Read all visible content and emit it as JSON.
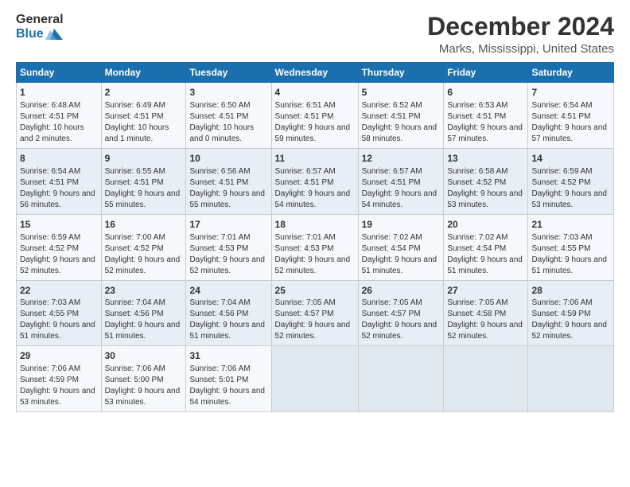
{
  "logo": {
    "general": "General",
    "blue": "Blue"
  },
  "title": "December 2024",
  "location": "Marks, Mississippi, United States",
  "days_header": [
    "Sunday",
    "Monday",
    "Tuesday",
    "Wednesday",
    "Thursday",
    "Friday",
    "Saturday"
  ],
  "weeks": [
    [
      {
        "day": "1",
        "sunrise": "Sunrise: 6:48 AM",
        "sunset": "Sunset: 4:51 PM",
        "daylight": "Daylight: 10 hours and 2 minutes."
      },
      {
        "day": "2",
        "sunrise": "Sunrise: 6:49 AM",
        "sunset": "Sunset: 4:51 PM",
        "daylight": "Daylight: 10 hours and 1 minute."
      },
      {
        "day": "3",
        "sunrise": "Sunrise: 6:50 AM",
        "sunset": "Sunset: 4:51 PM",
        "daylight": "Daylight: 10 hours and 0 minutes."
      },
      {
        "day": "4",
        "sunrise": "Sunrise: 6:51 AM",
        "sunset": "Sunset: 4:51 PM",
        "daylight": "Daylight: 9 hours and 59 minutes."
      },
      {
        "day": "5",
        "sunrise": "Sunrise: 6:52 AM",
        "sunset": "Sunset: 4:51 PM",
        "daylight": "Daylight: 9 hours and 58 minutes."
      },
      {
        "day": "6",
        "sunrise": "Sunrise: 6:53 AM",
        "sunset": "Sunset: 4:51 PM",
        "daylight": "Daylight: 9 hours and 57 minutes."
      },
      {
        "day": "7",
        "sunrise": "Sunrise: 6:54 AM",
        "sunset": "Sunset: 4:51 PM",
        "daylight": "Daylight: 9 hours and 57 minutes."
      }
    ],
    [
      {
        "day": "8",
        "sunrise": "Sunrise: 6:54 AM",
        "sunset": "Sunset: 4:51 PM",
        "daylight": "Daylight: 9 hours and 56 minutes."
      },
      {
        "day": "9",
        "sunrise": "Sunrise: 6:55 AM",
        "sunset": "Sunset: 4:51 PM",
        "daylight": "Daylight: 9 hours and 55 minutes."
      },
      {
        "day": "10",
        "sunrise": "Sunrise: 6:56 AM",
        "sunset": "Sunset: 4:51 PM",
        "daylight": "Daylight: 9 hours and 55 minutes."
      },
      {
        "day": "11",
        "sunrise": "Sunrise: 6:57 AM",
        "sunset": "Sunset: 4:51 PM",
        "daylight": "Daylight: 9 hours and 54 minutes."
      },
      {
        "day": "12",
        "sunrise": "Sunrise: 6:57 AM",
        "sunset": "Sunset: 4:51 PM",
        "daylight": "Daylight: 9 hours and 54 minutes."
      },
      {
        "day": "13",
        "sunrise": "Sunrise: 6:58 AM",
        "sunset": "Sunset: 4:52 PM",
        "daylight": "Daylight: 9 hours and 53 minutes."
      },
      {
        "day": "14",
        "sunrise": "Sunrise: 6:59 AM",
        "sunset": "Sunset: 4:52 PM",
        "daylight": "Daylight: 9 hours and 53 minutes."
      }
    ],
    [
      {
        "day": "15",
        "sunrise": "Sunrise: 6:59 AM",
        "sunset": "Sunset: 4:52 PM",
        "daylight": "Daylight: 9 hours and 52 minutes."
      },
      {
        "day": "16",
        "sunrise": "Sunrise: 7:00 AM",
        "sunset": "Sunset: 4:52 PM",
        "daylight": "Daylight: 9 hours and 52 minutes."
      },
      {
        "day": "17",
        "sunrise": "Sunrise: 7:01 AM",
        "sunset": "Sunset: 4:53 PM",
        "daylight": "Daylight: 9 hours and 52 minutes."
      },
      {
        "day": "18",
        "sunrise": "Sunrise: 7:01 AM",
        "sunset": "Sunset: 4:53 PM",
        "daylight": "Daylight: 9 hours and 52 minutes."
      },
      {
        "day": "19",
        "sunrise": "Sunrise: 7:02 AM",
        "sunset": "Sunset: 4:54 PM",
        "daylight": "Daylight: 9 hours and 51 minutes."
      },
      {
        "day": "20",
        "sunrise": "Sunrise: 7:02 AM",
        "sunset": "Sunset: 4:54 PM",
        "daylight": "Daylight: 9 hours and 51 minutes."
      },
      {
        "day": "21",
        "sunrise": "Sunrise: 7:03 AM",
        "sunset": "Sunset: 4:55 PM",
        "daylight": "Daylight: 9 hours and 51 minutes."
      }
    ],
    [
      {
        "day": "22",
        "sunrise": "Sunrise: 7:03 AM",
        "sunset": "Sunset: 4:55 PM",
        "daylight": "Daylight: 9 hours and 51 minutes."
      },
      {
        "day": "23",
        "sunrise": "Sunrise: 7:04 AM",
        "sunset": "Sunset: 4:56 PM",
        "daylight": "Daylight: 9 hours and 51 minutes."
      },
      {
        "day": "24",
        "sunrise": "Sunrise: 7:04 AM",
        "sunset": "Sunset: 4:56 PM",
        "daylight": "Daylight: 9 hours and 51 minutes."
      },
      {
        "day": "25",
        "sunrise": "Sunrise: 7:05 AM",
        "sunset": "Sunset: 4:57 PM",
        "daylight": "Daylight: 9 hours and 52 minutes."
      },
      {
        "day": "26",
        "sunrise": "Sunrise: 7:05 AM",
        "sunset": "Sunset: 4:57 PM",
        "daylight": "Daylight: 9 hours and 52 minutes."
      },
      {
        "day": "27",
        "sunrise": "Sunrise: 7:05 AM",
        "sunset": "Sunset: 4:58 PM",
        "daylight": "Daylight: 9 hours and 52 minutes."
      },
      {
        "day": "28",
        "sunrise": "Sunrise: 7:06 AM",
        "sunset": "Sunset: 4:59 PM",
        "daylight": "Daylight: 9 hours and 52 minutes."
      }
    ],
    [
      {
        "day": "29",
        "sunrise": "Sunrise: 7:06 AM",
        "sunset": "Sunset: 4:59 PM",
        "daylight": "Daylight: 9 hours and 53 minutes."
      },
      {
        "day": "30",
        "sunrise": "Sunrise: 7:06 AM",
        "sunset": "Sunset: 5:00 PM",
        "daylight": "Daylight: 9 hours and 53 minutes."
      },
      {
        "day": "31",
        "sunrise": "Sunrise: 7:06 AM",
        "sunset": "Sunset: 5:01 PM",
        "daylight": "Daylight: 9 hours and 54 minutes."
      },
      null,
      null,
      null,
      null
    ]
  ]
}
